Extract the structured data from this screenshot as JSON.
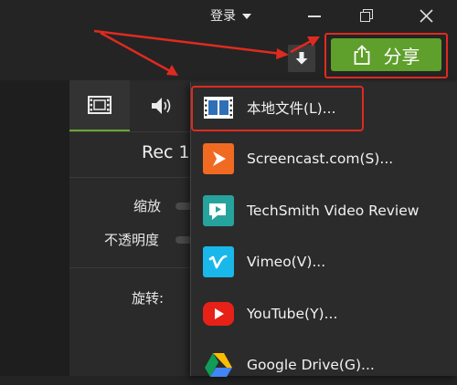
{
  "titlebar": {
    "login_label": "登录"
  },
  "share": {
    "label": "分享"
  },
  "editor": {
    "clip_title": "Rec 1",
    "props": [
      {
        "label": "缩放"
      },
      {
        "label": "不透明度"
      },
      {
        "label": "旋转:"
      }
    ]
  },
  "share_menu": {
    "items": [
      {
        "label": "本地文件(L)...",
        "icon": "film-icon"
      },
      {
        "label": "Screencast.com(S)...",
        "icon": "screencast-icon"
      },
      {
        "label": "TechSmith Video Review",
        "icon": "video-review-icon"
      },
      {
        "label": "Vimeo(V)...",
        "icon": "vimeo-icon"
      },
      {
        "label": "YouTube(Y)...",
        "icon": "youtube-icon"
      },
      {
        "label": "Google Drive(G)...",
        "icon": "google-drive-icon"
      }
    ]
  },
  "colors": {
    "share_button": "#5f9f2b",
    "highlight_red": "#e02a20",
    "screencast": "#f16a22",
    "video_review": "#26a39d",
    "vimeo": "#1ab7ea",
    "youtube": "#e62117"
  }
}
